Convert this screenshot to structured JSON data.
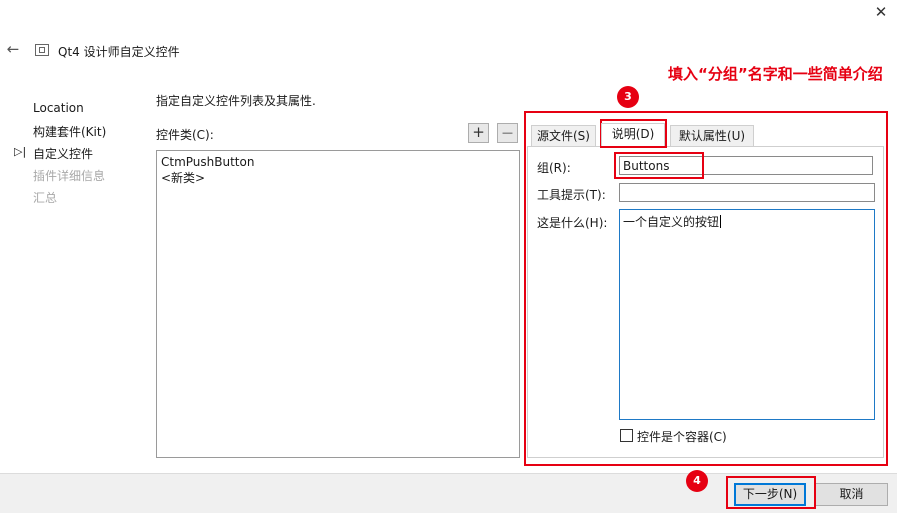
{
  "window": {
    "title": "Qt4 设计师自定义控件"
  },
  "icons": {
    "close": "close-icon",
    "back": "back-arrow-icon",
    "app": "app-icon"
  },
  "nav": {
    "items": [
      {
        "label": "Location",
        "state": "done"
      },
      {
        "label": "构建套件(Kit)",
        "state": "done"
      },
      {
        "label": "自定义控件",
        "state": "current"
      },
      {
        "label": "插件详细信息",
        "state": "pending"
      },
      {
        "label": "汇总",
        "state": "pending"
      }
    ],
    "current_marker": "▷|"
  },
  "main": {
    "description": "指定自定义控件列表及其属性.",
    "class_list_label": "控件类(C):",
    "add_symbol": "+",
    "remove_symbol": "—",
    "classes": [
      "CtmPushButton",
      "<新类>"
    ]
  },
  "tabs": [
    {
      "label": "源文件(S)",
      "active": false
    },
    {
      "label": "说明(D)",
      "active": true
    },
    {
      "label": "默认属性(U)",
      "active": false
    }
  ],
  "form": {
    "group_label": "组(R):",
    "group_value": "Buttons",
    "tooltip_label": "工具提示(T):",
    "tooltip_value": "",
    "whatsthis_label": "这是什么(H):",
    "whatsthis_value": "一个自定义的按钮",
    "container_label": "控件是个容器(C)",
    "container_checked": false
  },
  "footer": {
    "next_label": "下一步(N)",
    "cancel_label": "取消"
  },
  "annotations": {
    "badge3": "3",
    "badge4": "4",
    "note": "填入“分组”名字和一些简单介绍",
    "highlight_color": "#e60012"
  }
}
